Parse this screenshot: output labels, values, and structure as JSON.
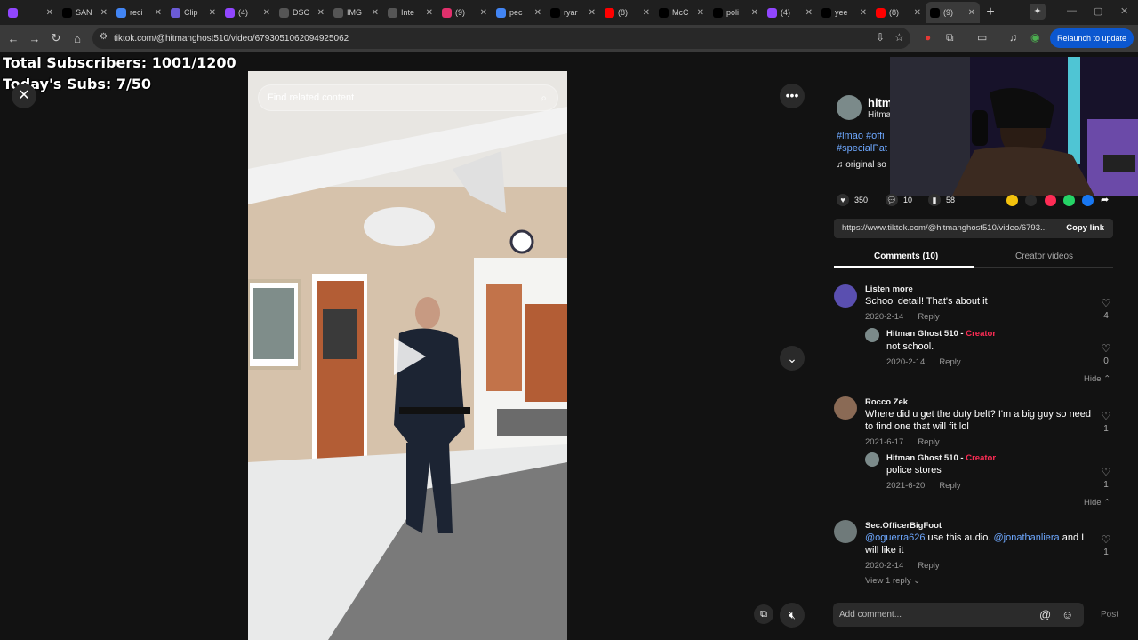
{
  "browser": {
    "tabs": [
      {
        "title": "",
        "fav": "#9146ff"
      },
      {
        "title": "SAN",
        "fav": "#000"
      },
      {
        "title": "reci",
        "fav": "#4285f4"
      },
      {
        "title": "Clip",
        "fav": "#6b5bd6"
      },
      {
        "title": "(4)",
        "fav": "#9146ff"
      },
      {
        "title": "DSC",
        "fav": "#555"
      },
      {
        "title": "IMG",
        "fav": "#555"
      },
      {
        "title": "Inte",
        "fav": "#555"
      },
      {
        "title": "(9)",
        "fav": "#e1306c"
      },
      {
        "title": "pec",
        "fav": "#4285f4"
      },
      {
        "title": "ryar",
        "fav": "#000"
      },
      {
        "title": "(8)",
        "fav": "#ff0000"
      },
      {
        "title": "McC",
        "fav": "#000"
      },
      {
        "title": "poli",
        "fav": "#000"
      },
      {
        "title": "(4)",
        "fav": "#9146ff"
      },
      {
        "title": "yee",
        "fav": "#000"
      },
      {
        "title": "(8)",
        "fav": "#ff0000"
      },
      {
        "title": "(9)",
        "fav": "#000"
      }
    ],
    "url": "tiktok.com/@hitmanghost510/video/6793051062094925062",
    "relaunch_label": "Relaunch to update"
  },
  "stream_overlay": {
    "total_subs": "Total Subscribers: 1001/1200",
    "today_subs": "Today's Subs: 7/50"
  },
  "video": {
    "search_placeholder": "Find related content"
  },
  "author": {
    "name": "hitm",
    "handle": "Hitma",
    "tags": "#lmao #offi #specialPat",
    "sound": "original so"
  },
  "stats": {
    "likes": "350",
    "comments": "10",
    "saves": "58"
  },
  "link": {
    "url": "https://www.tiktok.com/@hitmanghost510/video/6793...",
    "copy_label": "Copy link"
  },
  "panel_tabs": {
    "comments": "Comments (10)",
    "creator_videos": "Creator videos"
  },
  "comments": [
    {
      "user": "Listen more",
      "text": "School detail! That's about it",
      "date": "2020-2-14",
      "reply": "Reply",
      "likes": "4"
    },
    {
      "user": "Hitman Ghost 510",
      "badge": "Creator",
      "text": "not school.",
      "date": "2020-2-14",
      "reply": "Reply",
      "likes": "0"
    },
    {
      "user": "Rocco Zek",
      "text": "Where did u get the duty belt? I'm a big guy so need to find one that will fit lol",
      "date": "2021-6-17",
      "reply": "Reply",
      "likes": "1"
    },
    {
      "user": "Hitman Ghost 510",
      "badge": "Creator",
      "text": "police stores",
      "date": "2021-6-20",
      "reply": "Reply",
      "likes": "1"
    },
    {
      "user": "Sec.OfficerBigFoot",
      "mention1": "@oguerra626",
      "mid": " use this audio. ",
      "mention2": "@jonathanliera",
      "tail": " and I will like it",
      "date": "2020-2-14",
      "reply": "Reply",
      "likes": "1"
    }
  ],
  "hide_label": "Hide",
  "view_reply": "View 1 reply",
  "add_comment": {
    "placeholder": "Add comment...",
    "post_label": "Post"
  }
}
